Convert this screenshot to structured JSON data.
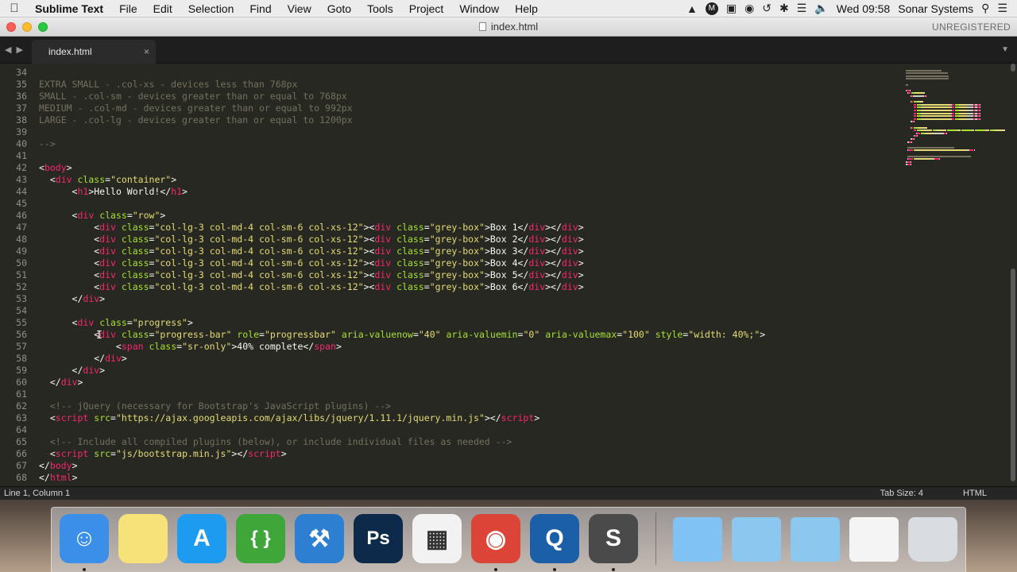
{
  "menubar": {
    "app_name": "Sublime Text",
    "items": [
      "File",
      "Edit",
      "Selection",
      "Find",
      "View",
      "Goto",
      "Tools",
      "Project",
      "Window",
      "Help"
    ],
    "clock": "Wed 09:58",
    "user": "Sonar Systems"
  },
  "window": {
    "title": "index.html",
    "unregistered": "UNREGISTERED"
  },
  "tabs": [
    {
      "label": "index.html",
      "close": "×"
    }
  ],
  "editor": {
    "line_numbers": [
      "34",
      "35",
      "36",
      "37",
      "38",
      "39",
      "40",
      "41",
      "42",
      "43",
      "44",
      "45",
      "46",
      "47",
      "48",
      "49",
      "50",
      "51",
      "52",
      "53",
      "54",
      "55",
      "56",
      "57",
      "58",
      "59",
      "60",
      "61",
      "62",
      "63",
      "64",
      "65",
      "66",
      "67",
      "68"
    ],
    "lines": [
      [],
      [
        [
          "com",
          "EXTRA SMALL - .col-xs - devices less than 768px"
        ]
      ],
      [
        [
          "com",
          "SMALL - .col-sm - devices greater than or equal to 768px"
        ]
      ],
      [
        [
          "com",
          "MEDIUM - .col-md - devices greater than or equal to 992px"
        ]
      ],
      [
        [
          "com",
          "LARGE - .col-lg - devices greater than or equal to 1200px"
        ]
      ],
      [],
      [
        [
          "com",
          "-->"
        ]
      ],
      [],
      [
        [
          "txt",
          "<"
        ],
        [
          "tag",
          "body"
        ],
        [
          "txt",
          ">"
        ]
      ],
      [
        [
          "txt",
          "  <"
        ],
        [
          "tag",
          "div"
        ],
        [
          "txt",
          " "
        ],
        [
          "attr",
          "class"
        ],
        [
          "txt",
          "="
        ],
        [
          "str",
          "\"container\""
        ],
        [
          "txt",
          ">"
        ]
      ],
      [
        [
          "txt",
          "      <"
        ],
        [
          "tag",
          "h1"
        ],
        [
          "txt",
          ">Hello World!</"
        ],
        [
          "tag",
          "h1"
        ],
        [
          "txt",
          ">"
        ]
      ],
      [],
      [
        [
          "txt",
          "      <"
        ],
        [
          "tag",
          "div"
        ],
        [
          "txt",
          " "
        ],
        [
          "attr",
          "class"
        ],
        [
          "txt",
          "="
        ],
        [
          "str",
          "\"row\""
        ],
        [
          "txt",
          ">"
        ]
      ],
      [
        [
          "txt",
          "          <"
        ],
        [
          "tag",
          "div"
        ],
        [
          "txt",
          " "
        ],
        [
          "attr",
          "class"
        ],
        [
          "txt",
          "="
        ],
        [
          "str",
          "\"col-lg-3 col-md-4 col-sm-6 col-xs-12\""
        ],
        [
          "txt",
          "><"
        ],
        [
          "tag",
          "div"
        ],
        [
          "txt",
          " "
        ],
        [
          "attr",
          "class"
        ],
        [
          "txt",
          "="
        ],
        [
          "str",
          "\"grey-box\""
        ],
        [
          "txt",
          ">Box 1</"
        ],
        [
          "tag",
          "div"
        ],
        [
          "txt",
          "></"
        ],
        [
          "tag",
          "div"
        ],
        [
          "txt",
          ">"
        ]
      ],
      [
        [
          "txt",
          "          <"
        ],
        [
          "tag",
          "div"
        ],
        [
          "txt",
          " "
        ],
        [
          "attr",
          "class"
        ],
        [
          "txt",
          "="
        ],
        [
          "str",
          "\"col-lg-3 col-md-4 col-sm-6 col-xs-12\""
        ],
        [
          "txt",
          "><"
        ],
        [
          "tag",
          "div"
        ],
        [
          "txt",
          " "
        ],
        [
          "attr",
          "class"
        ],
        [
          "txt",
          "="
        ],
        [
          "str",
          "\"grey-box\""
        ],
        [
          "txt",
          ">Box 2</"
        ],
        [
          "tag",
          "div"
        ],
        [
          "txt",
          "></"
        ],
        [
          "tag",
          "div"
        ],
        [
          "txt",
          ">"
        ]
      ],
      [
        [
          "txt",
          "          <"
        ],
        [
          "tag",
          "div"
        ],
        [
          "txt",
          " "
        ],
        [
          "attr",
          "class"
        ],
        [
          "txt",
          "="
        ],
        [
          "str",
          "\"col-lg-3 col-md-4 col-sm-6 col-xs-12\""
        ],
        [
          "txt",
          "><"
        ],
        [
          "tag",
          "div"
        ],
        [
          "txt",
          " "
        ],
        [
          "attr",
          "class"
        ],
        [
          "txt",
          "="
        ],
        [
          "str",
          "\"grey-box\""
        ],
        [
          "txt",
          ">Box 3</"
        ],
        [
          "tag",
          "div"
        ],
        [
          "txt",
          "></"
        ],
        [
          "tag",
          "div"
        ],
        [
          "txt",
          ">"
        ]
      ],
      [
        [
          "txt",
          "          <"
        ],
        [
          "tag",
          "div"
        ],
        [
          "txt",
          " "
        ],
        [
          "attr",
          "class"
        ],
        [
          "txt",
          "="
        ],
        [
          "str",
          "\"col-lg-3 col-md-4 col-sm-6 col-xs-12\""
        ],
        [
          "txt",
          "><"
        ],
        [
          "tag",
          "div"
        ],
        [
          "txt",
          " "
        ],
        [
          "attr",
          "class"
        ],
        [
          "txt",
          "="
        ],
        [
          "str",
          "\"grey-box\""
        ],
        [
          "txt",
          ">Box 4</"
        ],
        [
          "tag",
          "div"
        ],
        [
          "txt",
          "></"
        ],
        [
          "tag",
          "div"
        ],
        [
          "txt",
          ">"
        ]
      ],
      [
        [
          "txt",
          "          <"
        ],
        [
          "tag",
          "div"
        ],
        [
          "txt",
          " "
        ],
        [
          "attr",
          "class"
        ],
        [
          "txt",
          "="
        ],
        [
          "str",
          "\"col-lg-3 col-md-4 col-sm-6 col-xs-12\""
        ],
        [
          "txt",
          "><"
        ],
        [
          "tag",
          "div"
        ],
        [
          "txt",
          " "
        ],
        [
          "attr",
          "class"
        ],
        [
          "txt",
          "="
        ],
        [
          "str",
          "\"grey-box\""
        ],
        [
          "txt",
          ">Box 5</"
        ],
        [
          "tag",
          "div"
        ],
        [
          "txt",
          "></"
        ],
        [
          "tag",
          "div"
        ],
        [
          "txt",
          ">"
        ]
      ],
      [
        [
          "txt",
          "          <"
        ],
        [
          "tag",
          "div"
        ],
        [
          "txt",
          " "
        ],
        [
          "attr",
          "class"
        ],
        [
          "txt",
          "="
        ],
        [
          "str",
          "\"col-lg-3 col-md-4 col-sm-6 col-xs-12\""
        ],
        [
          "txt",
          "><"
        ],
        [
          "tag",
          "div"
        ],
        [
          "txt",
          " "
        ],
        [
          "attr",
          "class"
        ],
        [
          "txt",
          "="
        ],
        [
          "str",
          "\"grey-box\""
        ],
        [
          "txt",
          ">Box 6</"
        ],
        [
          "tag",
          "div"
        ],
        [
          "txt",
          "></"
        ],
        [
          "tag",
          "div"
        ],
        [
          "txt",
          ">"
        ]
      ],
      [
        [
          "txt",
          "      </"
        ],
        [
          "tag",
          "div"
        ],
        [
          "txt",
          ">"
        ]
      ],
      [],
      [
        [
          "txt",
          "      <"
        ],
        [
          "tag",
          "div"
        ],
        [
          "txt",
          " "
        ],
        [
          "attr",
          "class"
        ],
        [
          "txt",
          "="
        ],
        [
          "str",
          "\"progress\""
        ],
        [
          "txt",
          ">"
        ]
      ],
      [
        [
          "txt",
          "          <"
        ],
        [
          "tag",
          "div"
        ],
        [
          "txt",
          " "
        ],
        [
          "attr",
          "class"
        ],
        [
          "txt",
          "="
        ],
        [
          "str",
          "\"progress-bar\""
        ],
        [
          "txt",
          " "
        ],
        [
          "attr",
          "role"
        ],
        [
          "txt",
          "="
        ],
        [
          "str",
          "\"progressbar\""
        ],
        [
          "txt",
          " "
        ],
        [
          "attr",
          "aria-valuenow"
        ],
        [
          "txt",
          "="
        ],
        [
          "str",
          "\"40\""
        ],
        [
          "txt",
          " "
        ],
        [
          "attr",
          "aria-valuemin"
        ],
        [
          "txt",
          "="
        ],
        [
          "str",
          "\"0\""
        ],
        [
          "txt",
          " "
        ],
        [
          "attr",
          "aria-valuemax"
        ],
        [
          "txt",
          "="
        ],
        [
          "str",
          "\"100\""
        ],
        [
          "txt",
          " "
        ],
        [
          "attr",
          "style"
        ],
        [
          "txt",
          "="
        ],
        [
          "str",
          "\"width: 40%;\""
        ],
        [
          "txt",
          ">"
        ]
      ],
      [
        [
          "txt",
          "              <"
        ],
        [
          "tag",
          "span"
        ],
        [
          "txt",
          " "
        ],
        [
          "attr",
          "class"
        ],
        [
          "txt",
          "="
        ],
        [
          "str",
          "\"sr-only\""
        ],
        [
          "txt",
          ">40% complete</"
        ],
        [
          "tag",
          "span"
        ],
        [
          "txt",
          ">"
        ]
      ],
      [
        [
          "txt",
          "          </"
        ],
        [
          "tag",
          "div"
        ],
        [
          "txt",
          ">"
        ]
      ],
      [
        [
          "txt",
          "      </"
        ],
        [
          "tag",
          "div"
        ],
        [
          "txt",
          ">"
        ]
      ],
      [
        [
          "txt",
          "  </"
        ],
        [
          "tag",
          "div"
        ],
        [
          "txt",
          ">"
        ]
      ],
      [],
      [
        [
          "com",
          "  <!-- jQuery (necessary for Bootstrap's JavaScript plugins) -->"
        ]
      ],
      [
        [
          "txt",
          "  <"
        ],
        [
          "tag",
          "script"
        ],
        [
          "txt",
          " "
        ],
        [
          "attr",
          "src"
        ],
        [
          "txt",
          "="
        ],
        [
          "str",
          "\"https://ajax.googleapis.com/ajax/libs/jquery/1.11.1/jquery.min.js\""
        ],
        [
          "txt",
          "></"
        ],
        [
          "tag",
          "script"
        ],
        [
          "txt",
          ">"
        ]
      ],
      [],
      [
        [
          "com",
          "  <!-- Include all compiled plugins (below), or include individual files as needed -->"
        ]
      ],
      [
        [
          "txt",
          "  <"
        ],
        [
          "tag",
          "script"
        ],
        [
          "txt",
          " "
        ],
        [
          "attr",
          "src"
        ],
        [
          "txt",
          "="
        ],
        [
          "str",
          "\"js/bootstrap.min.js\""
        ],
        [
          "txt",
          "></"
        ],
        [
          "tag",
          "script"
        ],
        [
          "txt",
          ">"
        ]
      ],
      [
        [
          "txt",
          "</"
        ],
        [
          "tag",
          "body"
        ],
        [
          "txt",
          ">"
        ]
      ],
      [
        [
          "txt",
          "</"
        ],
        [
          "tag",
          "html"
        ],
        [
          "txt",
          ">"
        ]
      ]
    ]
  },
  "statusbar": {
    "position": "Line 1, Column 1",
    "tab_size": "Tab Size: 4",
    "syntax": "HTML"
  },
  "dock": {
    "apps": [
      {
        "name": "finder-icon",
        "color": "#3c8fe8",
        "glyph": "☺",
        "running": true
      },
      {
        "name": "notes-icon",
        "color": "#f7e27a",
        "glyph": "",
        "running": false
      },
      {
        "name": "app-store-icon",
        "color": "#1d9bf0",
        "glyph": "A",
        "running": false
      },
      {
        "name": "brackets-icon",
        "color": "#3fa63a",
        "glyph": "{ }",
        "running": false
      },
      {
        "name": "xcode-icon",
        "color": "#2d7fd2",
        "glyph": "⚒",
        "running": false
      },
      {
        "name": "photoshop-icon",
        "color": "#0e2a4a",
        "glyph": "Ps",
        "running": false
      },
      {
        "name": "launchpad-icon",
        "color": "#f2f2f2",
        "glyph": "▦",
        "running": false
      },
      {
        "name": "chrome-icon",
        "color": "#db4437",
        "glyph": "◉",
        "running": true
      },
      {
        "name": "quicktime-icon",
        "color": "#1a5fa8",
        "glyph": "Q",
        "running": true
      },
      {
        "name": "sublime-text-icon",
        "color": "#4a4a4a",
        "glyph": "S",
        "running": true
      }
    ],
    "stacks": [
      {
        "name": "applications-folder-icon",
        "color": "#7fc2f3"
      },
      {
        "name": "documents-folder-icon",
        "color": "#8cc7f0"
      },
      {
        "name": "downloads-folder-icon",
        "color": "#8cc7f0"
      },
      {
        "name": "chrome-window-thumbnail-icon",
        "color": "#f4f4f4"
      },
      {
        "name": "trash-icon",
        "color": "#d9dde2"
      }
    ]
  }
}
